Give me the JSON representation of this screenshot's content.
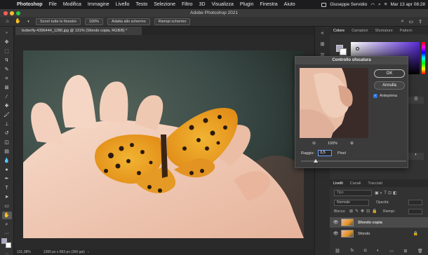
{
  "menubar": {
    "items": [
      "Photoshop",
      "File",
      "Modifica",
      "Immagine",
      "Livello",
      "Testo",
      "Selezione",
      "Filtro",
      "3D",
      "Visualizza",
      "Plugin",
      "Finestra",
      "Aiuto"
    ],
    "user": "Giuseppe Servidio",
    "datetime": "Mar 13 apr 08:28"
  },
  "window": {
    "title": "Adobe Photoshop 2021"
  },
  "options": {
    "scroll_all": "Scorri tutte le finestre",
    "zoom": "100%",
    "fit_screen": "Adatta allo schermo",
    "fill_screen": "Riempi schermo"
  },
  "document": {
    "tab": "butterfly-4396444_1280.jpg @ 131% (Sfondo copia, RGB/8) *",
    "zoom": "131,38%",
    "size": "1280 px x 853 px (300 ppi)"
  },
  "panels": {
    "top_tabs": [
      "Colore",
      "Campioni",
      "Sfumature",
      "Pattern"
    ],
    "layer_tabs": [
      "Livelli",
      "Canali",
      "Tracciati"
    ],
    "search_placeholder": "Tipo",
    "opacity_label": "Opacità:",
    "fill_label": "Riempi:",
    "lock_label": "Blocca:",
    "blend_mode": "Normale",
    "layers": [
      {
        "name": "Sfondo copia"
      },
      {
        "name": "Sfondo"
      }
    ]
  },
  "dialog": {
    "title": "Controllo sfocatura",
    "ok": "OK",
    "cancel": "Annulla",
    "preview": "Anteprima",
    "zoom": "100%",
    "radius_label": "Raggio:",
    "radius_value": "3,5",
    "radius_unit": "Pixel",
    "radius_fraction": 0.14
  },
  "colors": {
    "accent": "#2d6fd6",
    "bg": "#262626"
  }
}
